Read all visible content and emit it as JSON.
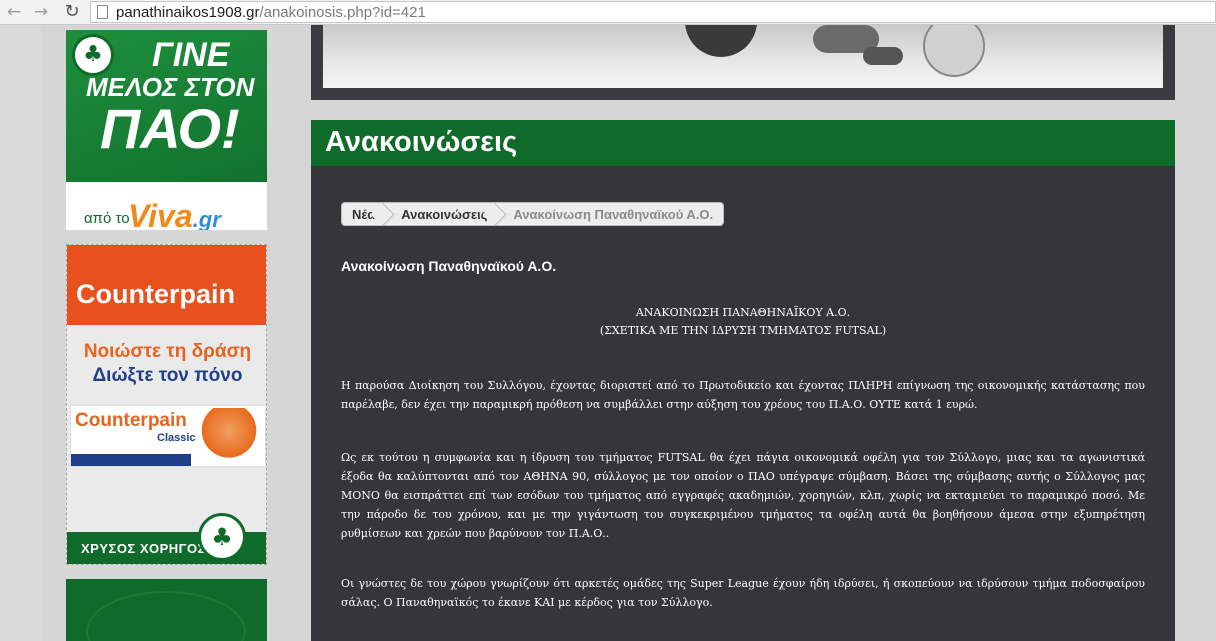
{
  "browser": {
    "back_icon": "arrow-left",
    "forward_icon": "arrow-right",
    "reload_icon": "reload",
    "url_host": "panathinaikos1908.gr",
    "url_path": "/anakoinosis.php?id=421"
  },
  "ads": {
    "membership": {
      "line1": "ΓΙΝΕ",
      "line2": "ΜΕΛΟΣ ΣΤΟΝ",
      "line3": "ΠΑΟ!",
      "from": "από το",
      "brand": "Viva",
      "brand_tld": ".gr",
      "logo_year": "1908"
    },
    "counterpain": {
      "brand": "Counterpain",
      "slogan1": "Νοιώστε τη δράση",
      "slogan2": "Διώξτε τον πόνο",
      "product": "Counterpain",
      "product_variant": "Classic",
      "sponsor_label": "ΧΡΥΣΟΣ ΧΟΡΗΓΟΣ",
      "logo_year": "1908"
    }
  },
  "section": {
    "title": "Ανακοινώσεις"
  },
  "breadcrumb": {
    "items": [
      "Νέα",
      "Ανακοινώσεις",
      "Ανακοίνωση Παναθηναϊκού Α.Ο."
    ]
  },
  "article": {
    "title": "Ανακοίνωση Παναθηναϊκού Α.Ο.",
    "heading1": "ΑΝΑΚΟΙΝΩΣΗ ΠΑΝΑΘΗΝΑΪΚΟΥ Α.Ο.",
    "heading2": "(ΣΧΕΤΙΚΑ ΜΕ ΤΗΝ ΙΔΡΥΣΗ ΤΜΗΜΑΤΟΣ FUTSAL)",
    "paragraphs": [
      "Η παρούσα Διοίκηση του Συλλόγου, έχοντας διοριστεί από το Πρωτοδικείο και έχοντας ΠΛΗΡΗ επίγνωση της οικονομικής κατάστασης που παρέλαβε, δεν έχει την παραμικρή πρόθεση να συμβάλλει στην αύξηση του χρέους του Π.Α.Ο. ΟΥΤΕ κατά 1 ευρώ.",
      "Ως εκ τούτου η συμφωνία και η ίδρυση του τμήματος FUTSAL θα έχει πάγια οικονομικά οφέλη για τον Σύλλογο, μιας και τα αγωνιστικά έξοδα θα καλύπτονται από τον ΑΘΗΝΑ 90, σύλλογος με τον οποίον ο ΠΑΟ υπέγραψε σύμβαση. Βάσει της σύμβασης αυτής ο Σύλλογος μας ΜΟΝΟ θα εισπράττει επί των εσόδων του τμήματος από εγγραφές ακαδημιών, χορηγιών, κλπ, χωρίς να εκταμιεύει το παραμικρό ποσό. Με την πάροδο δε του χρόνου, και με την γιγάντωση του συγκεκριμένου τμήματος τα οφέλη αυτά θα βοηθήσουν άμεσα στην εξυπηρέτηση ρυθμίσεων και χρεών που βαρύνουν τον Π.Α.Ο..",
      "Οι γνώστες δε του χώρου γνωρίζουν ότι αρκετές ομάδες της Super League έχουν ήδη ιδρύσει, ή σκοπεύουν να ιδρύσουν τμήμα ποδοσφαίρου σάλας. Ο Παναθηναϊκός το έκανε ΚΑΙ με κέρδος για τον Σύλλογο."
    ]
  }
}
